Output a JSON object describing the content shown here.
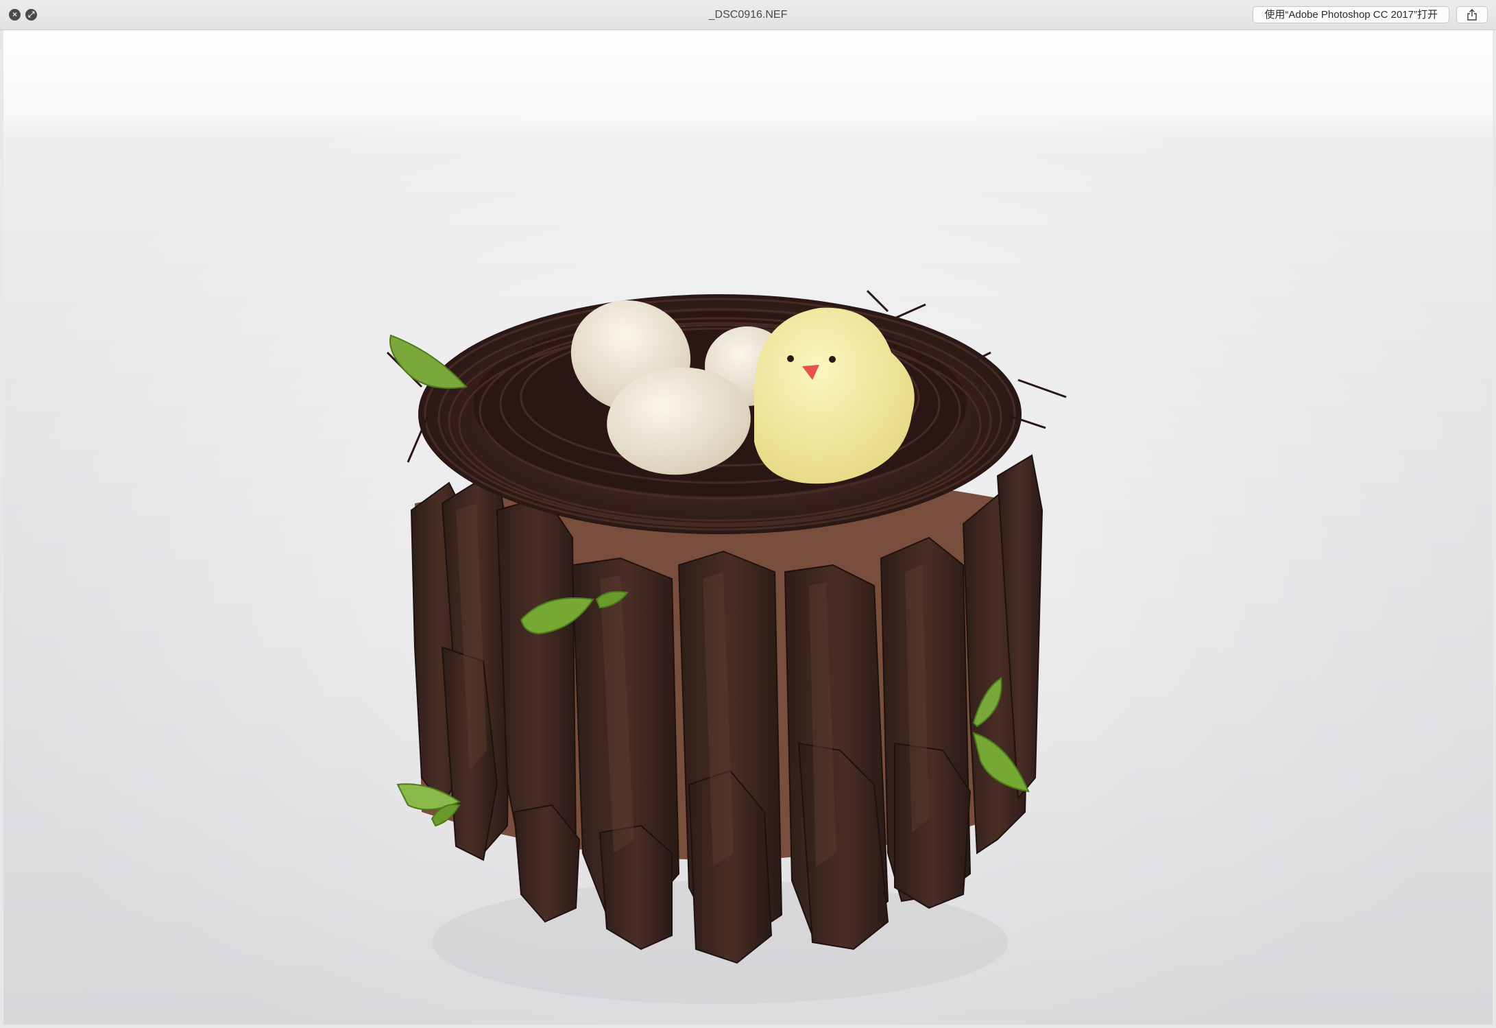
{
  "window": {
    "title": "_DSC0916.NEF",
    "open_with_label": "使用“Adobe Photoshop CC 2017”打开"
  },
  "icons": {
    "close": "close-icon",
    "fullscreen": "fullscreen-icon",
    "share": "share-icon"
  },
  "colors": {
    "titlebar": "#e6e6e8",
    "background_top": "#ffffff",
    "background_floor": "#dcdcde",
    "chocolate": "#3a2420",
    "cake_body": "#8a5a45",
    "egg": "#f1e9da",
    "chick": "#f5eea0",
    "leaf": "#6a9a2a"
  }
}
